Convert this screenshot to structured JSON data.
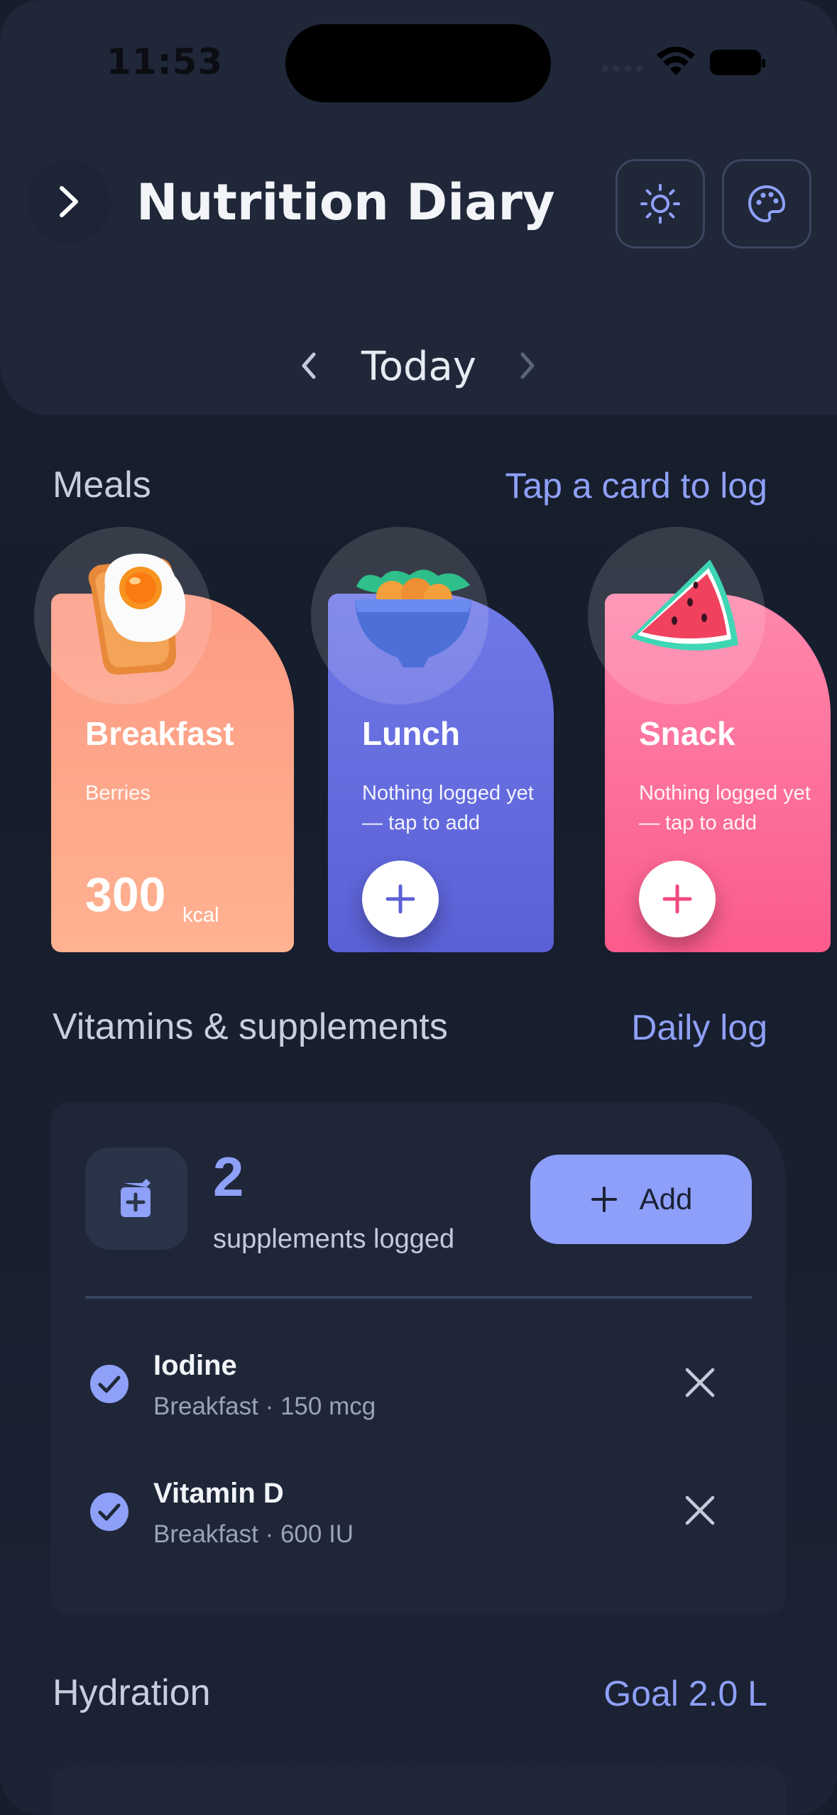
{
  "status_bar": {
    "time": "11:53"
  },
  "header": {
    "title": "Nutrition Diary",
    "menu_icon": "chevron-right-icon",
    "theme_icon": "sun-icon",
    "palette_icon": "palette-icon"
  },
  "date_nav": {
    "label": "Today"
  },
  "meals": {
    "title": "Meals",
    "hint": "Tap a card to log",
    "cards": [
      {
        "name": "Breakfast",
        "note": "Berries",
        "kcal": "300",
        "unit": "kcal",
        "icon": "fried-egg-toast",
        "color_top": "#fc9a84",
        "color_bottom": "#ffb291"
      },
      {
        "name": "Lunch",
        "note": "Nothing logged yet — tap to add",
        "icon": "salad-bowl",
        "color_top": "#7079e8",
        "color_bottom": "#5b60d6"
      },
      {
        "name": "Snack",
        "note": "Nothing logged yet — tap to add",
        "icon": "watermelon-slice",
        "color_top": "#ff88ad",
        "color_bottom": "#fb5b8c"
      }
    ]
  },
  "supplements": {
    "title": "Vitamins & supplements",
    "link": "Daily log",
    "count": "2",
    "count_label": "supplements logged",
    "add_label": "Add",
    "items": [
      {
        "name": "Iodine",
        "meta": "Breakfast · 150 mcg"
      },
      {
        "name": "Vitamin D",
        "meta": "Breakfast · 600 IU"
      }
    ]
  },
  "hydration": {
    "title": "Hydration",
    "goal": "Goal 2.0 L"
  },
  "colors": {
    "accent": "#8fa0f8",
    "background": "#161d2b",
    "panel": "#1f2739"
  }
}
